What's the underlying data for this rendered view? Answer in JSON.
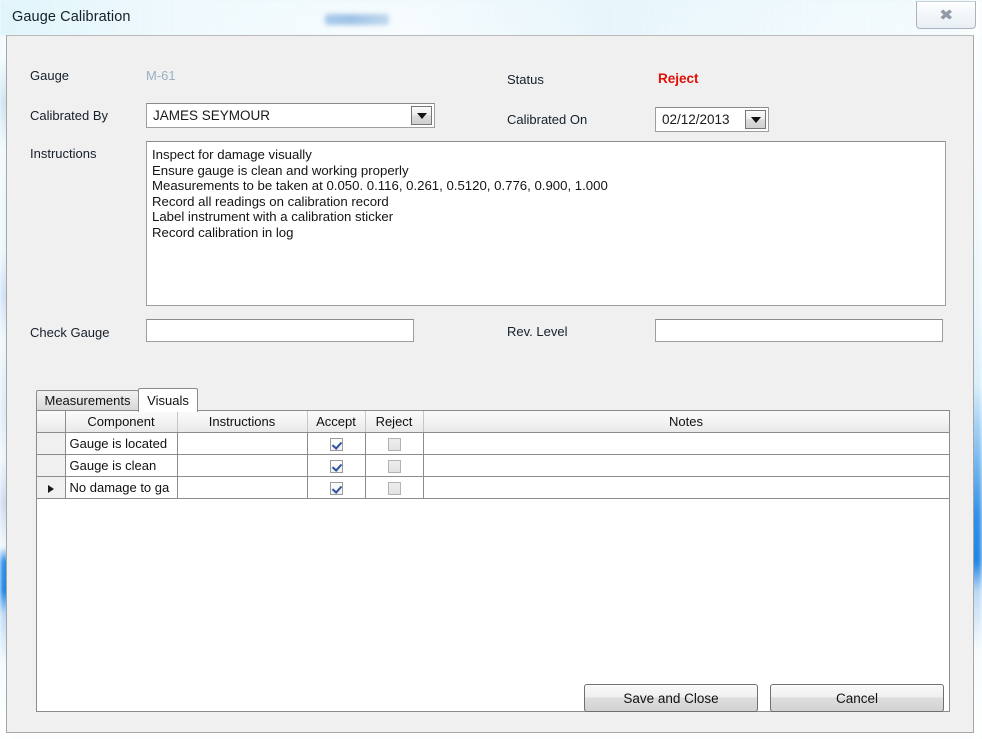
{
  "window": {
    "title": "Gauge Calibration",
    "close_icon": "close-x-icon"
  },
  "form": {
    "gauge_label": "Gauge",
    "gauge_value": "M-61",
    "calibrated_by_label": "Calibrated By",
    "calibrated_by_value": "JAMES SEYMOUR",
    "status_label": "Status",
    "status_value": "Reject",
    "status_color": "#e10f08",
    "calibrated_on_label": "Calibrated On",
    "calibrated_on_value": "02/12/2013",
    "instructions_label": "Instructions",
    "instructions_lines": [
      "Inspect for damage visually",
      "Ensure gauge is clean and working properly",
      "Measurements to be taken at 0.050. 0.116, 0.261, 0.5120, 0.776, 0.900, 1.000",
      "Record all readings on calibration record",
      "Label instrument with a calibration sticker",
      "Record calibration in log"
    ],
    "check_gauge_label": "Check Gauge",
    "check_gauge_value": "",
    "rev_level_label": "Rev. Level",
    "rev_level_value": "",
    "dropdown_icon": "chevron-down-icon"
  },
  "tabs": [
    {
      "label": "Measurements",
      "active": false
    },
    {
      "label": "Visuals",
      "active": true
    }
  ],
  "grid": {
    "columns": [
      "",
      "Component",
      "Instructions",
      "Accept",
      "Reject",
      "Notes"
    ],
    "rows": [
      {
        "selector": "",
        "component": "Gauge is located",
        "instructions": "",
        "accept": true,
        "reject": false,
        "notes": ""
      },
      {
        "selector": "",
        "component": "Gauge is clean",
        "instructions": "",
        "accept": true,
        "reject": false,
        "notes": ""
      },
      {
        "selector": "row-marker",
        "component": "No damage to ga",
        "instructions": "",
        "accept": true,
        "reject": false,
        "notes": ""
      }
    ]
  },
  "footer": {
    "save_label": "Save and Close",
    "cancel_label": "Cancel"
  }
}
